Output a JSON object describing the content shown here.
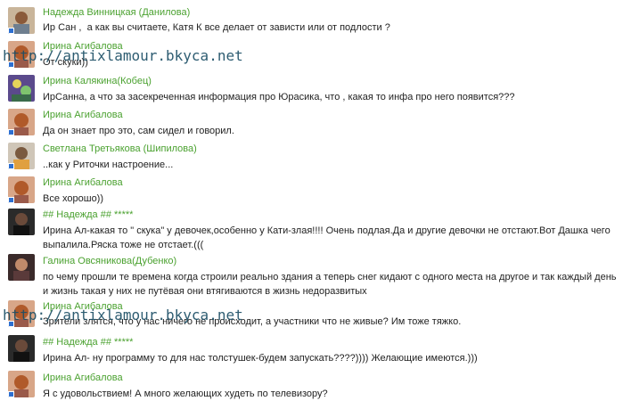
{
  "watermark": "http://antixlamour.bkyca.net",
  "comments": [
    {
      "author": "Надежда Винницкая (Данилова)",
      "text": "Ир Сан ,  а как вы считаете, Катя К все делает от зависти или от подлости ?"
    },
    {
      "author": "Ирина Агибалова",
      "text": "От скуки))"
    },
    {
      "author": "Ирина Калякина(Кобец)",
      "text": "ИрСанна, а что за засекреченная информация про Юрасика, что , какая то инфа про него появится???"
    },
    {
      "author": "Ирина Агибалова",
      "text": "Да он знает про это, сам сидел и говорил."
    },
    {
      "author": "Светлана Третьякова (Шипилова)",
      "text": "..как у Риточки настроение..."
    },
    {
      "author": "Ирина Агибалова",
      "text": "Все хорошо))"
    },
    {
      "author": "## Надежда ## *****",
      "text": "Ирина Ал-какая то \" скука\" у девочек,особенно у Кати-злая!!!! Очень подлая.Да и другие девочки не отстают.Вот Дашка чего выпалила.Ряска тоже не отстает.((("
    },
    {
      "author": "Галина Овсяникова(Дубенко)",
      "text": "по чему прошли те времена когда строили реально здания а теперь снег кидают с одного места на другое и так каждый день и жизнь такая у них не путёвая они втягиваются в жизнь недоразвитых"
    },
    {
      "author": "Ирина Агибалова",
      "text": "Зрители злятся, что у нас ничего не происходит, а участники что не живые? Им тоже тяжко."
    },
    {
      "author": "## Надежда ## *****",
      "text": "Ирина Ал- ну программу то для нас толстушек-будем запускать????)))) Желающие имеются.)))"
    },
    {
      "author": "Ирина Агибалова",
      "text": "Я с удовольствием! А много желающих худеть по телевизору?"
    }
  ]
}
